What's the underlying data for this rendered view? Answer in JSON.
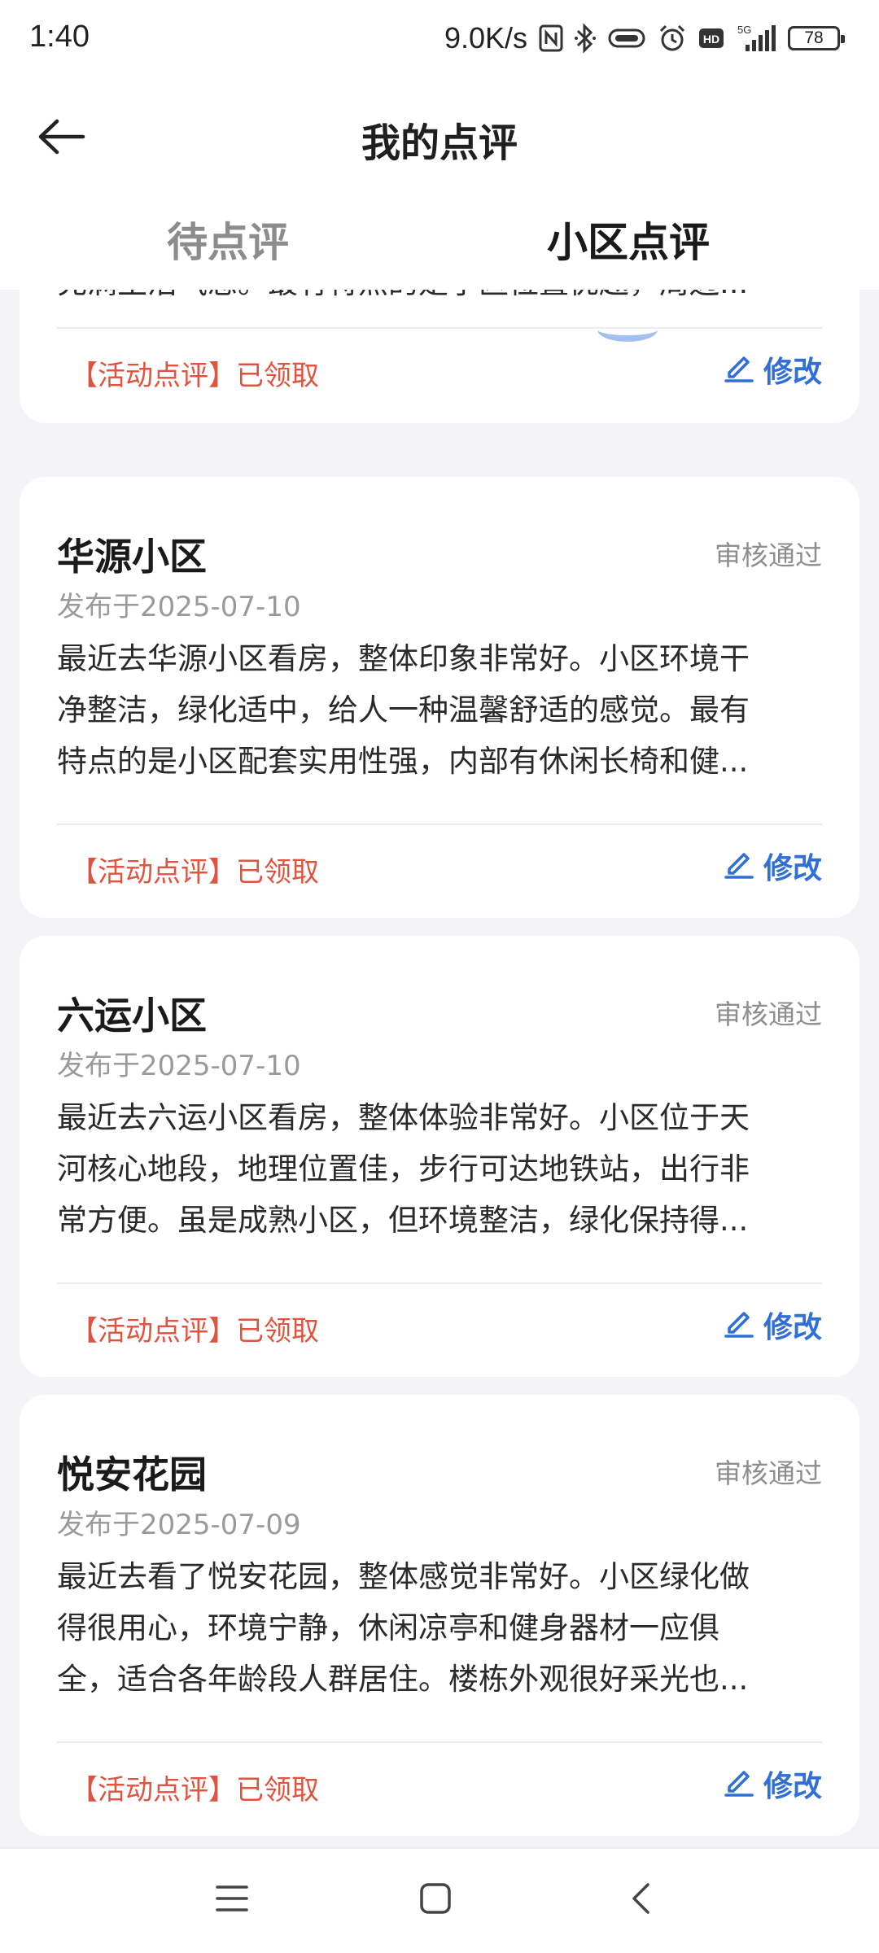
{
  "status_bar": {
    "time": "1:40",
    "network_speed": "9.0K/s",
    "network_type": "5G",
    "battery": "78"
  },
  "header": {
    "title": "我的点评",
    "back_icon": "arrow-left-icon",
    "tabs": [
      {
        "label": "待点评",
        "active": false
      },
      {
        "label": "小区点评",
        "active": true
      }
    ],
    "accent_color": "#2f6fd6"
  },
  "partial_card": {
    "text_line": "充满生活气息。最有特点的是小区位置优越，周边...",
    "activity": "【活动点评】已领取",
    "edit_label": "修改"
  },
  "cards": [
    {
      "name": "华源小区",
      "status": "审核通过",
      "date": "发布于2025-07-10",
      "lines": [
        "最近去华源小区看房，整体印象非常好。小区环境干",
        "净整洁，绿化适中，给人一种温馨舒适的感觉。最有",
        "特点的是小区配套实用性强，内部有休闲长椅和健..."
      ],
      "activity": "【活动点评】已领取",
      "edit_label": "修改"
    },
    {
      "name": "六运小区",
      "status": "审核通过",
      "date": "发布于2025-07-10",
      "lines": [
        "最近去六运小区看房，整体体验非常好。小区位于天",
        "河核心地段，地理位置佳，步行可达地铁站，出行非",
        "常方便。虽是成熟小区，但环境整洁，绿化保持得..."
      ],
      "activity": "【活动点评】已领取",
      "edit_label": "修改"
    },
    {
      "name": "悦安花园",
      "status": "审核通过",
      "date": "发布于2025-07-09",
      "lines": [
        "最近去看了悦安花园，整体感觉非常好。小区绿化做",
        "得很用心，环境宁静，休闲凉亭和健身器材一应俱",
        "全，适合各年龄段人群居住。楼栋外观很好采光也..."
      ],
      "activity": "【活动点评】已领取",
      "edit_label": "修改"
    }
  ],
  "colors": {
    "activity_red": "#e0533f",
    "status_gray": "#8e8e8e",
    "background": "#f4f4f6"
  },
  "nav_bar": {
    "icons": [
      "menu-icon",
      "home-square-icon",
      "back-chevron-icon"
    ]
  }
}
